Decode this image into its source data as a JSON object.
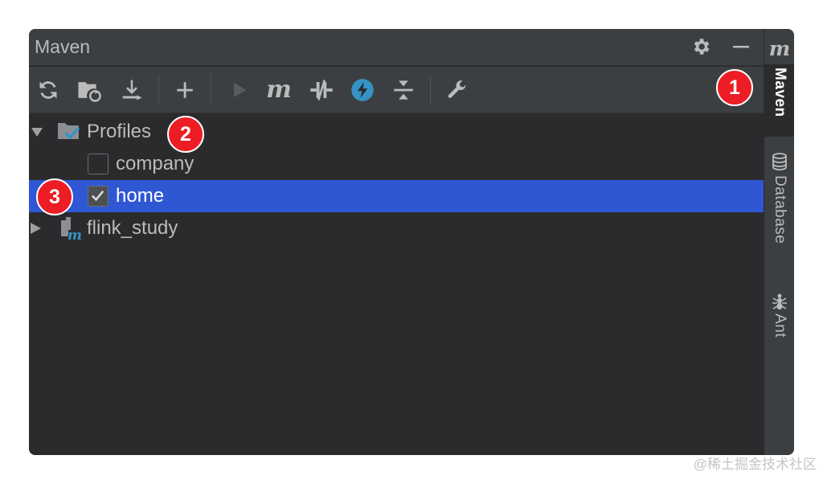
{
  "window": {
    "title": "Maven"
  },
  "titlebar": {
    "settings_icon": "gear-icon",
    "minimize_icon": "minimize-icon"
  },
  "toolbar": {
    "buttons": [
      {
        "name": "reload-all-maven-projects",
        "icon": "refresh-icon"
      },
      {
        "name": "generate-sources",
        "icon": "folder-refresh-icon"
      },
      {
        "name": "download-sources",
        "icon": "download-icon"
      },
      {
        "name": "add-maven-project",
        "icon": "plus-icon"
      },
      {
        "name": "run-maven-build",
        "icon": "play-icon"
      },
      {
        "name": "execute-maven-goal",
        "icon": "maven-m-icon",
        "label": "m"
      },
      {
        "name": "toggle-offline-mode",
        "icon": "offline-icon"
      },
      {
        "name": "toggle-skip-tests",
        "icon": "lightning-icon"
      },
      {
        "name": "collapse-all",
        "icon": "collapse-all-icon"
      },
      {
        "name": "maven-settings",
        "icon": "wrench-icon"
      }
    ]
  },
  "tree": {
    "profiles": {
      "label": "Profiles",
      "expanded": true
    },
    "profile_items": [
      {
        "label": "company",
        "checked": false
      },
      {
        "label": "home",
        "checked": true,
        "selected": true
      }
    ],
    "project": {
      "label": "flink_study",
      "expanded": false
    }
  },
  "badges": {
    "one": "1",
    "two": "2",
    "three": "3"
  },
  "sidebar": {
    "top_icon_label": "m",
    "tabs": [
      {
        "label": "Maven",
        "icon": "maven-icon",
        "active": true
      },
      {
        "label": "Database",
        "icon": "database-icon",
        "active": false
      },
      {
        "label": "Ant",
        "icon": "ant-icon",
        "active": false
      }
    ]
  },
  "watermark": "@稀土掘金技术社区",
  "colors": {
    "panel_bg": "#2b2b2d",
    "header_bg": "#3c3f41",
    "selection": "#2f57d4",
    "badge": "#ec1d24",
    "text": "#bbbbbb",
    "accent_blue": "#3592c4"
  }
}
